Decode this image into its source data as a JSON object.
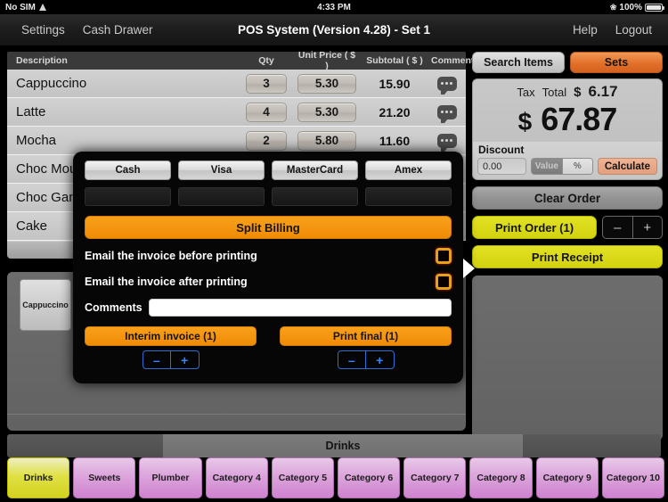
{
  "statusbar": {
    "carrier": "No SIM",
    "wifi_icon": "wifi-icon",
    "time": "4:33 PM",
    "bluetooth_icon": "bluetooth-icon",
    "battery_percent": "100%",
    "battery_icon": "battery-icon"
  },
  "navbar": {
    "settings": "Settings",
    "cash_drawer": "Cash Drawer",
    "title": "POS System (Version 4.28) - Set 1",
    "help": "Help",
    "logout": "Logout"
  },
  "order_table": {
    "headers": {
      "description": "Description",
      "qty": "Qty",
      "unit_price": "Unit Price ( $ )",
      "subtotal": "Subtotal ( $ )",
      "comment": "Comment"
    },
    "rows": [
      {
        "description": "Cappuccino",
        "qty": "3",
        "unit_price": "5.30",
        "subtotal": "15.90",
        "comment_icon": "comment-bubble-icon"
      },
      {
        "description": "Latte",
        "qty": "4",
        "unit_price": "5.30",
        "subtotal": "21.20",
        "comment_icon": "comment-bubble-icon"
      },
      {
        "description": "Mocha",
        "qty": "2",
        "unit_price": "5.80",
        "subtotal": "11.60",
        "comment_icon": "comment-bubble-icon"
      },
      {
        "description": "Choc Mou",
        "qty": "",
        "unit_price": "",
        "subtotal": "",
        "comment_icon": "comment-bubble-icon"
      },
      {
        "description": "Choc Gan",
        "qty": "",
        "unit_price": "",
        "subtotal": "",
        "comment_icon": "comment-bubble-icon"
      },
      {
        "description": "Cake",
        "qty": "",
        "unit_price": "",
        "subtotal": "",
        "comment_icon": "comment-bubble-icon"
      }
    ]
  },
  "items_pane": {
    "tiles": [
      {
        "label": "Cappuccino"
      }
    ]
  },
  "category_bar": {
    "active_label": "Drinks"
  },
  "tabs": [
    {
      "label": "Drinks",
      "active": true
    },
    {
      "label": "Sweets",
      "active": false
    },
    {
      "label": "Plumber",
      "active": false
    },
    {
      "label": "Category 4",
      "active": false
    },
    {
      "label": "Category 5",
      "active": false
    },
    {
      "label": "Category 6",
      "active": false
    },
    {
      "label": "Category 7",
      "active": false
    },
    {
      "label": "Category 8",
      "active": false
    },
    {
      "label": "Category 9",
      "active": false
    },
    {
      "label": "Category 10",
      "active": false
    }
  ],
  "right_panel": {
    "search_items": "Search Items",
    "sets": "Sets",
    "tax_label": "Tax",
    "total_label": "Total",
    "tax_currency": "$",
    "tax_value": "6.17",
    "total_currency": "$",
    "total_value": "67.87",
    "discount_label": "Discount",
    "discount_value": "0.00",
    "discount_placeholder": "0.00",
    "seg_value": "Value",
    "seg_percent": "%",
    "calculate": "Calculate",
    "clear_order": "Clear Order",
    "print_order": "Print Order (1)",
    "print_receipt": "Print Receipt",
    "stepper_minus": "–",
    "stepper_plus": "+"
  },
  "modal": {
    "payments": [
      {
        "label": "Cash",
        "field_value": ""
      },
      {
        "label": "Visa",
        "field_value": ""
      },
      {
        "label": "MasterCard",
        "field_value": ""
      },
      {
        "label": "Amex",
        "field_value": ""
      }
    ],
    "split_billing": "Split Billing",
    "email_before": "Email the invoice before printing",
    "email_after": "Email the invoice after printing",
    "comments_label": "Comments",
    "comments_value": "",
    "interim_invoice": "Interim invoice (1)",
    "print_final": "Print final (1)",
    "stepper_minus": "–",
    "stepper_plus": "+"
  },
  "colors": {
    "orange": "#f9a01b",
    "yellow": "#d2d20f",
    "sets_orange": "#e2702a",
    "tab_purple": "#cf82cf",
    "calculate_peach": "#e39f7d",
    "blue_stepper": "#2f86ff"
  }
}
